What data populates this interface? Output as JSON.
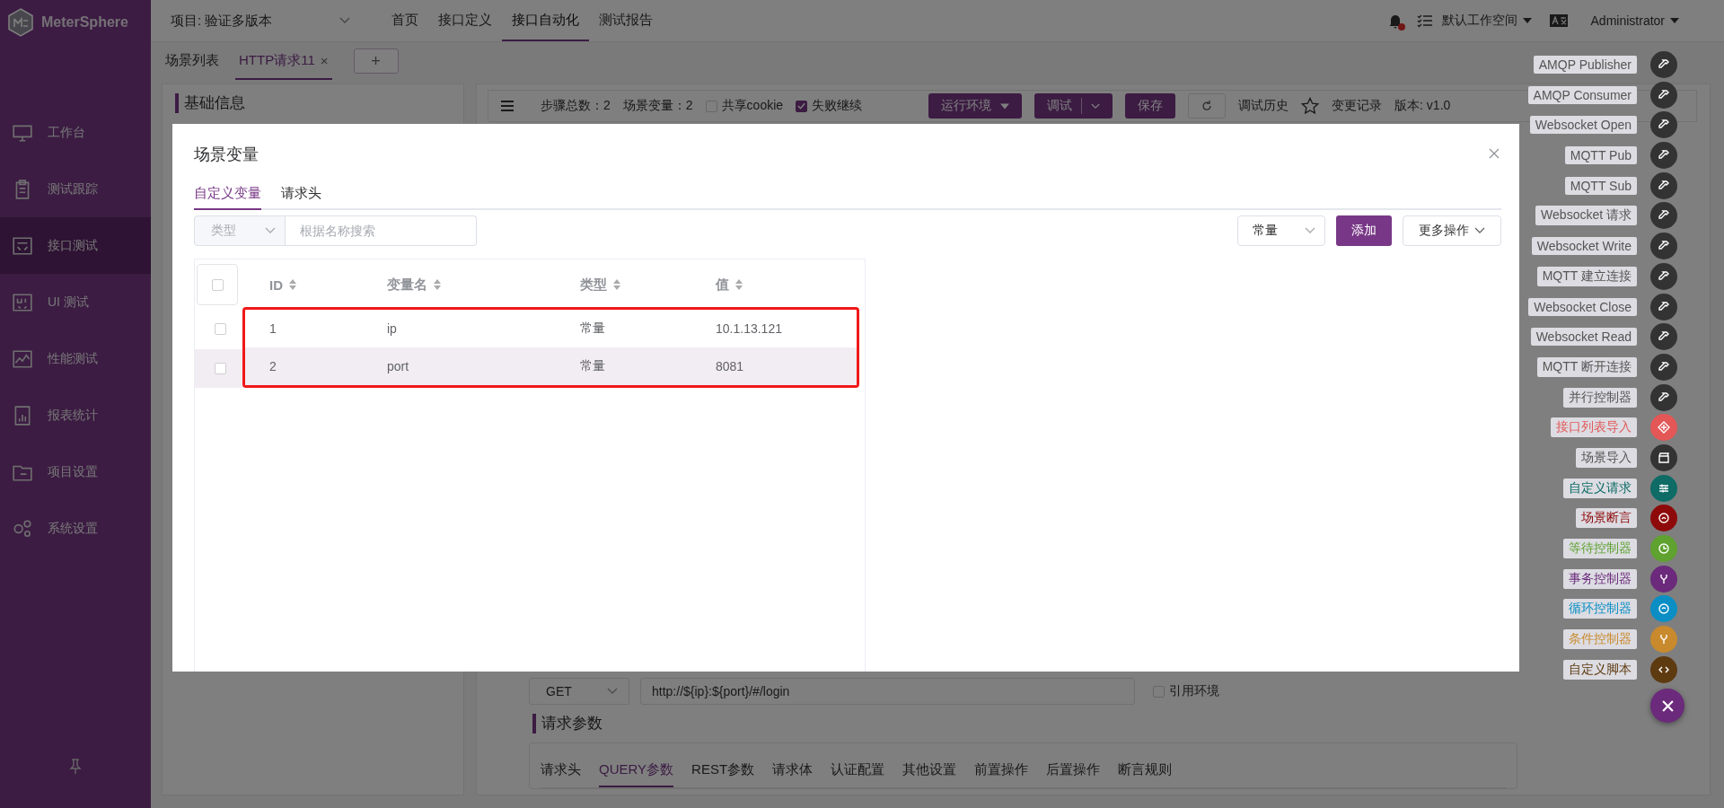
{
  "app": {
    "logo": "MeterSphere"
  },
  "sidebar": {
    "items": [
      {
        "label": "工作台",
        "kind": "monitor",
        "selected": false
      },
      {
        "label": "测试跟踪",
        "kind": "clipboard",
        "selected": false
      },
      {
        "label": "接口测试",
        "kind": "api",
        "selected": true
      },
      {
        "label": "UI 测试",
        "kind": "ui",
        "selected": false
      },
      {
        "label": "性能测试",
        "kind": "chart",
        "selected": false
      },
      {
        "label": "报表统计",
        "kind": "report",
        "selected": false
      },
      {
        "label": "项目设置",
        "kind": "folder",
        "selected": false
      },
      {
        "label": "系统设置",
        "kind": "gears",
        "selected": false
      }
    ]
  },
  "header": {
    "project": "项目: 验证多版本",
    "nav": [
      {
        "label": "首页",
        "selected": false
      },
      {
        "label": "接口定义",
        "selected": false
      },
      {
        "label": "接口自动化",
        "selected": true
      },
      {
        "label": "测试报告",
        "selected": false
      }
    ],
    "unread": true,
    "workspace": "默认工作空间",
    "user": "Administrator"
  },
  "scene_tabs": {
    "items": [
      {
        "label": "场景列表",
        "selected": false
      },
      {
        "label": "HTTP请求11",
        "selected": true,
        "close": "×"
      }
    ],
    "add": "+"
  },
  "basic_info": {
    "title": "基础信息"
  },
  "toolbar": {
    "step_count": "步骤总数：2",
    "variable_count": "场景变量：2",
    "options": [
      {
        "label": "共享cookie",
        "checked": false
      },
      {
        "label": "失败继续",
        "checked": true
      }
    ],
    "run_env": "运行环境",
    "debug": "调试",
    "save": "保存",
    "history": "调试历史",
    "changes": "变更记录",
    "version": "版本: v1.0"
  },
  "request": {
    "method": "GET",
    "url": "http://${ip}:${port}/#/login",
    "use_env": {
      "label": "引用环境",
      "checked": false
    },
    "params_title": "请求参数",
    "tabs": [
      {
        "label": "请求头",
        "selected": false
      },
      {
        "label": "QUERY参数",
        "selected": true
      },
      {
        "label": "REST参数",
        "selected": false
      },
      {
        "label": "请求体",
        "selected": false
      },
      {
        "label": "认证配置",
        "selected": false
      },
      {
        "label": "其他设置",
        "selected": false
      },
      {
        "label": "前置操作",
        "selected": false
      },
      {
        "label": "后置操作",
        "selected": false
      },
      {
        "label": "断言规则",
        "selected": false
      }
    ]
  },
  "step_palette": {
    "items": [
      {
        "label": "AMQP Publisher",
        "kind": "protocol",
        "color": "#333333"
      },
      {
        "label": "AMQP Consumer",
        "kind": "protocol",
        "color": "#333333"
      },
      {
        "label": "Websocket Open",
        "kind": "protocol",
        "color": "#333333"
      },
      {
        "label": "MQTT Pub",
        "kind": "protocol",
        "color": "#333333"
      },
      {
        "label": "MQTT Sub",
        "kind": "protocol",
        "color": "#333333"
      },
      {
        "label": "Websocket 请求",
        "kind": "protocol",
        "color": "#333333"
      },
      {
        "label": "Websocket Write",
        "kind": "protocol",
        "color": "#333333"
      },
      {
        "label": "MQTT 建立连接",
        "kind": "protocol",
        "color": "#333333"
      },
      {
        "label": "Websocket Close",
        "kind": "protocol",
        "color": "#333333"
      },
      {
        "label": "Websocket Read",
        "kind": "protocol",
        "color": "#333333"
      },
      {
        "label": "MQTT 断开连接",
        "kind": "protocol",
        "color": "#333333"
      },
      {
        "label": "并行控制器",
        "kind": "parallel",
        "color": "#333333"
      },
      {
        "label": "接口列表导入",
        "kind": "import",
        "color": "#e35757"
      },
      {
        "label": "场景导入",
        "kind": "scene_import",
        "color": "#333333"
      },
      {
        "label": "自定义请求",
        "kind": "request",
        "color": "#0e6b66"
      },
      {
        "label": "场景断言",
        "kind": "assertion",
        "color": "#8e0a0a"
      },
      {
        "label": "等待控制器",
        "kind": "wait",
        "color": "#5fa22f"
      },
      {
        "label": "事务控制器",
        "kind": "transaction",
        "color": "#6b2a7b"
      },
      {
        "label": "循环控制器",
        "kind": "loop",
        "color": "#0a8ec4"
      },
      {
        "label": "条件控制器",
        "kind": "condition",
        "color": "#c98a2d"
      },
      {
        "label": "自定义脚本",
        "kind": "script",
        "color": "#5e3a10"
      }
    ]
  },
  "modal": {
    "title": "场景变量",
    "tabs": [
      {
        "label": "自定义变量",
        "selected": true
      },
      {
        "label": "请求头",
        "selected": false
      }
    ],
    "type_filter": {
      "placeholder": "类型"
    },
    "search": {
      "placeholder": "根据名称搜索"
    },
    "type_select": {
      "value": "常量"
    },
    "add_button": "添加",
    "more_button": "更多操作",
    "table": {
      "columns": [
        "ID",
        "变量名",
        "类型",
        "值"
      ],
      "all_checked": false,
      "outlined": true,
      "rows": [
        {
          "id": "1",
          "name": "ip",
          "type": "常量",
          "value": "10.1.13.121",
          "checked": false,
          "hovered": false
        },
        {
          "id": "2",
          "name": "port",
          "type": "常量",
          "value": "8081",
          "checked": false,
          "hovered": true
        }
      ]
    }
  }
}
